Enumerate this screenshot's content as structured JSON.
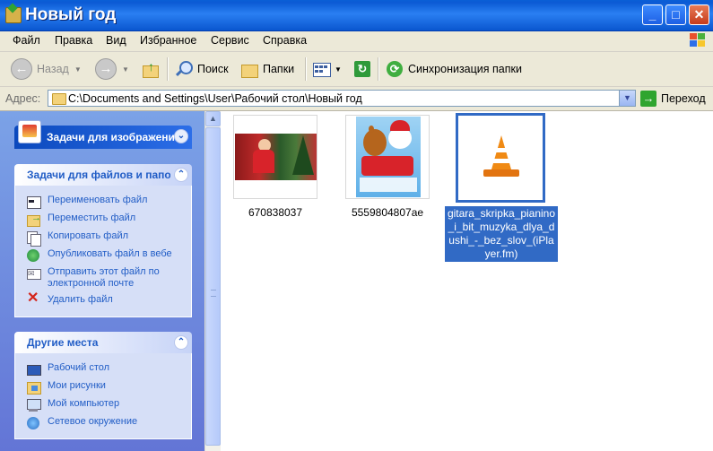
{
  "window": {
    "title": "Новый год"
  },
  "menu": [
    "Файл",
    "Правка",
    "Вид",
    "Избранное",
    "Сервис",
    "Справка"
  ],
  "toolbar": {
    "back_label": "Назад",
    "search_label": "Поиск",
    "folders_label": "Папки",
    "sync_label": "Синхронизация папки"
  },
  "address": {
    "label": "Адрес:",
    "path": "C:\\Documents and Settings\\User\\Рабочий стол\\Новый год",
    "go_label": "Переход"
  },
  "panels": {
    "image_tasks": {
      "title": "Задачи для изображений"
    },
    "file_tasks": {
      "title": "Задачи для файлов и папок",
      "items": [
        "Переименовать файл",
        "Переместить файл",
        "Копировать файл",
        "Опубликовать файл в вебе",
        "Отправить этот файл по электронной почте",
        "Удалить файл"
      ]
    },
    "other_places": {
      "title": "Другие места",
      "items": [
        "Рабочий стол",
        "Мои рисунки",
        "Мой компьютер",
        "Сетевое окружение"
      ]
    }
  },
  "files": [
    {
      "name": "670838037",
      "selected": false
    },
    {
      "name": "5559804807ae",
      "selected": false
    },
    {
      "name": "gitara_skripka_pianino_i_bit_muzyka_dlya_dushi_-_bez_slov_(iPlayer.fm)",
      "selected": true
    }
  ],
  "colors": {
    "titlebar": "#0a5fd6",
    "selection": "#316ac5",
    "taskpane": "#7ba2e7"
  }
}
